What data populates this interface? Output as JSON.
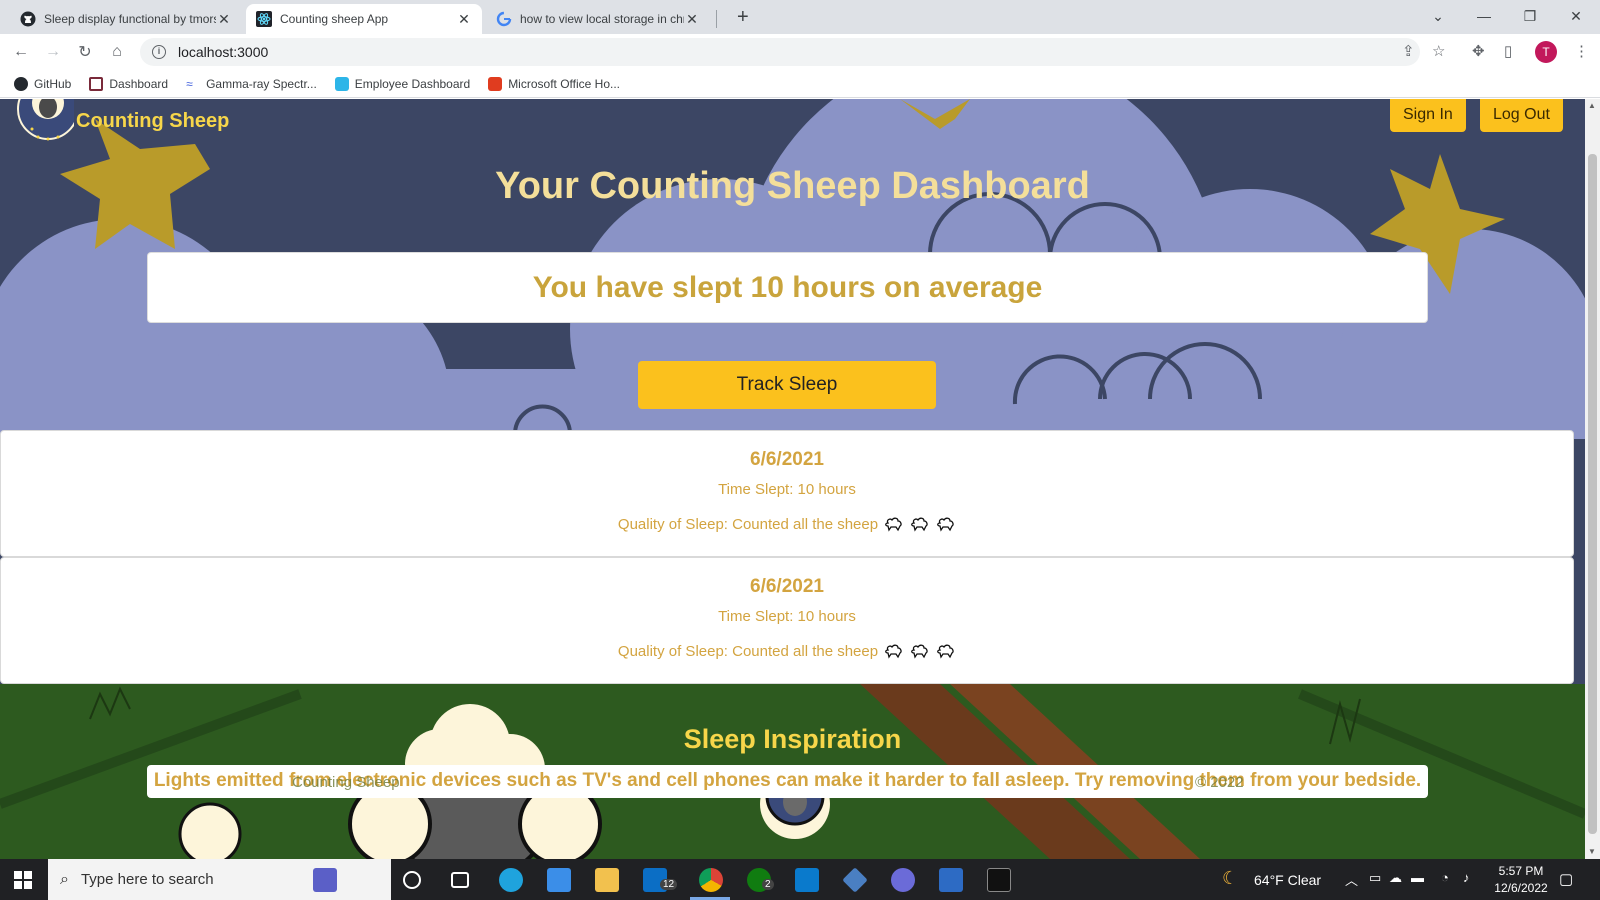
{
  "browser": {
    "tabs": [
      {
        "title": "Sleep display functional by tmors",
        "icon": "github-icon"
      },
      {
        "title": "Counting sheep App",
        "icon": "react-icon"
      },
      {
        "title": "how to view local storage in chro",
        "icon": "google-icon"
      }
    ],
    "url": "localhost:3000",
    "bookmarks": [
      {
        "label": "GitHub"
      },
      {
        "label": "Dashboard"
      },
      {
        "label": "Gamma-ray Spectr..."
      },
      {
        "label": "Employee Dashboard"
      },
      {
        "label": "Microsoft Office Ho..."
      }
    ],
    "profile_initial": "T"
  },
  "app": {
    "brand": "Counting Sheep",
    "nav": {
      "sign_in": "Sign In",
      "log_out": "Log Out"
    },
    "title": "Your Counting Sheep Dashboard",
    "average": "You have slept 10 hours on average",
    "track_button": "Track Sleep",
    "entries": [
      {
        "date": "6/6/2021",
        "time": "Time Slept: 10 hours",
        "quality": "Quality of Sleep: Counted all the sheep",
        "sheep_count": 3
      },
      {
        "date": "6/6/2021",
        "time": "Time Slept: 10 hours",
        "quality": "Quality of Sleep: Counted all the sheep",
        "sheep_count": 3
      }
    ],
    "inspiration_title": "Sleep Inspiration",
    "inspiration_text": "Lights emitted from electronic devices such as TV's and cell phones can make it harder to fall asleep. Try removing them from your bedside.",
    "footer_left": "Counting Sheep",
    "footer_right": "© 2022"
  },
  "taskbar": {
    "search_placeholder": "Type here to search",
    "mail_badge": "12",
    "xbox_badge": "2",
    "weather": "64°F  Clear",
    "time": "5:57 PM",
    "date": "12/6/2022"
  },
  "colors": {
    "accent_yellow": "#fbc11d",
    "text_gold": "#d3a440",
    "title_cream": "#f4df9a",
    "night_sky": "#3c4664",
    "cloud": "#8a93c6",
    "grass": "#2d5a1f"
  }
}
